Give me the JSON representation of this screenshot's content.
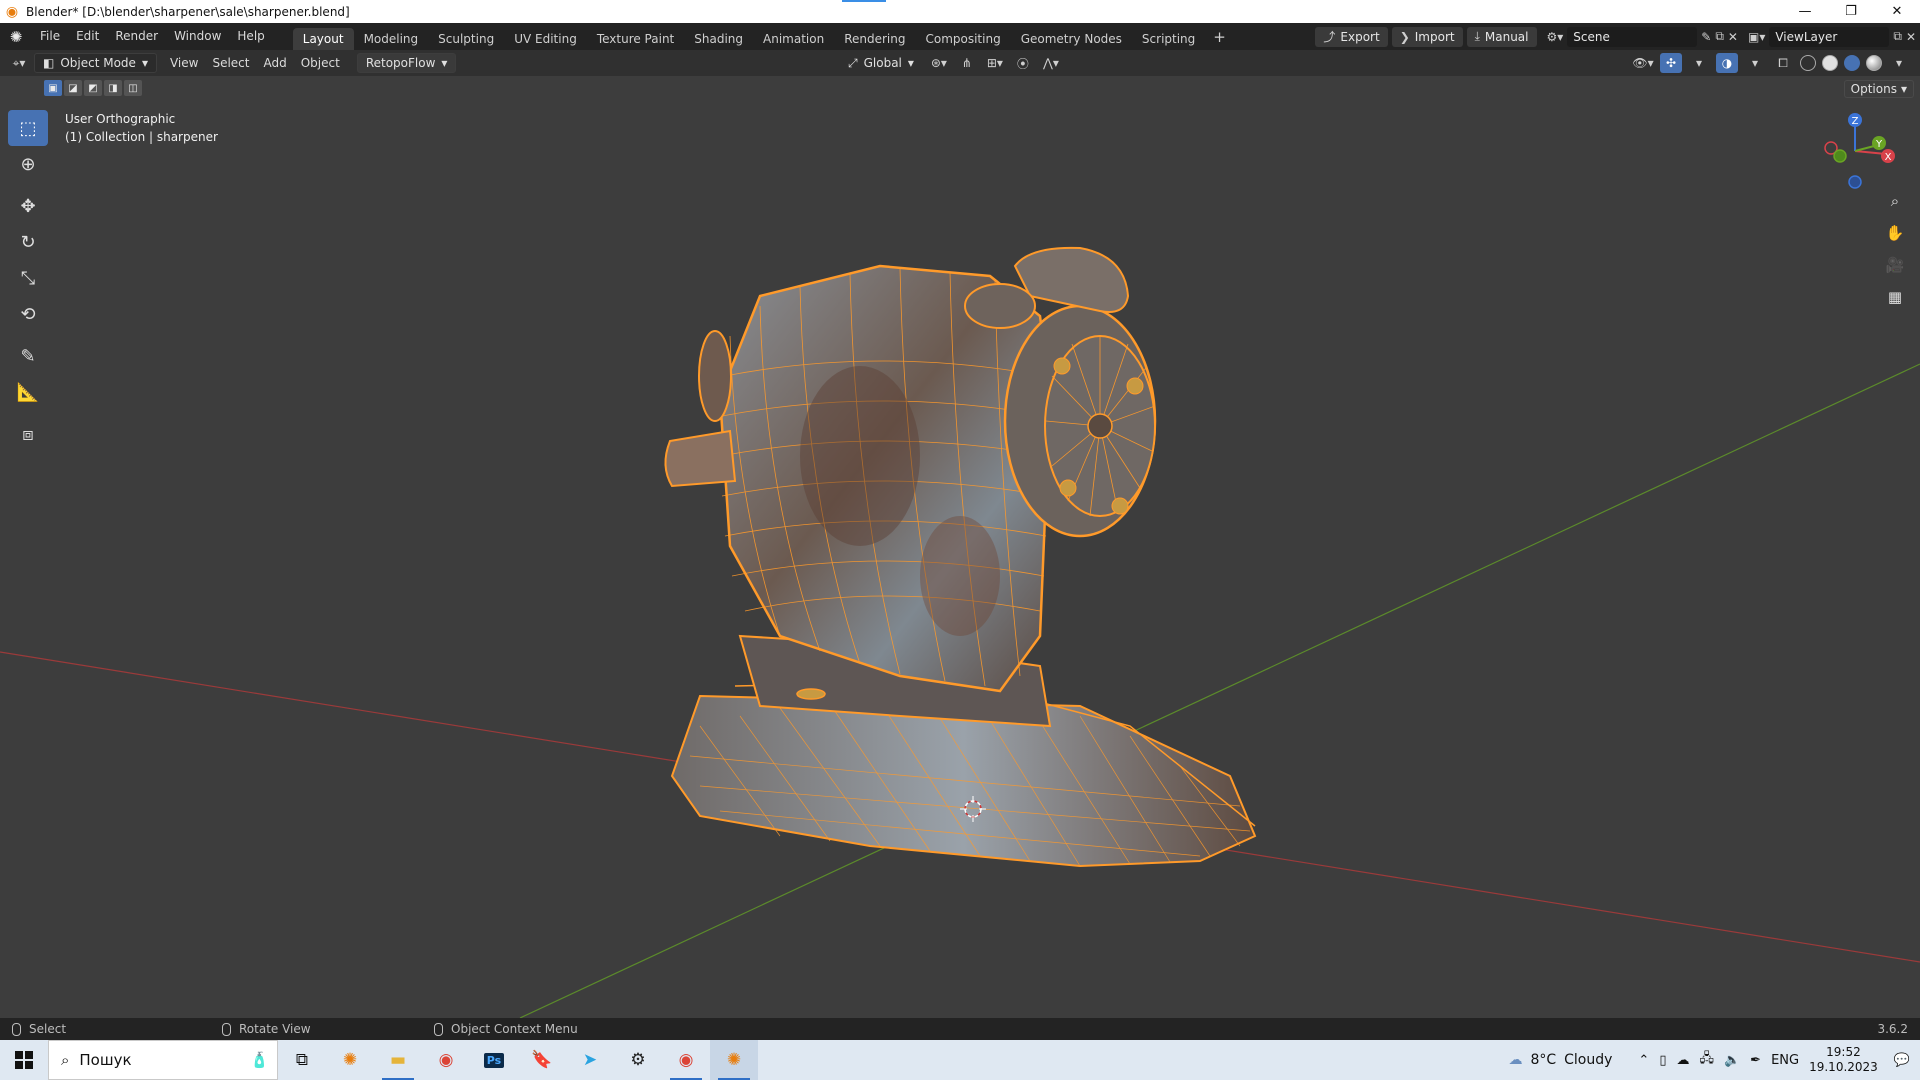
{
  "window": {
    "title": "Blender* [D:\\blender\\sharpener\\sale\\sharpener.blend]",
    "app_icon": "blender-icon",
    "buttons": [
      "minimize",
      "restore",
      "close"
    ]
  },
  "menu": {
    "items": [
      "File",
      "Edit",
      "Render",
      "Window",
      "Help"
    ]
  },
  "workspaces": {
    "tabs": [
      "Layout",
      "Modeling",
      "Sculpting",
      "UV Editing",
      "Texture Paint",
      "Shading",
      "Animation",
      "Rendering",
      "Compositing",
      "Geometry Nodes",
      "Scripting"
    ],
    "active": "Layout",
    "add_label": "+"
  },
  "topbar_right": {
    "export_label": "Export",
    "import_label": "Import",
    "manual_label": "Manual",
    "scene_name": "Scene",
    "view_layer": "ViewLayer"
  },
  "viewport_header": {
    "mode": "Object Mode",
    "menus": [
      "View",
      "Select",
      "Add",
      "Object"
    ],
    "addon_menu": "RetopoFlow",
    "transform_orientation": "Global",
    "options_label": "Options"
  },
  "viewport": {
    "view_name": "User Orthographic",
    "collection_info": "(1) Collection | sharpener",
    "object_name": "sharpener",
    "mesh_color": "#ff9a2a",
    "x_axis_color": "#9b3a3a",
    "y_axis_color": "#5b8a2b",
    "background": "#3d3d3d",
    "gizmo": {
      "x": "X",
      "y": "Y",
      "z": "Z"
    }
  },
  "toolbar": {
    "tools": [
      "select-box-icon",
      "cursor-icon",
      "move-icon",
      "rotate-icon",
      "scale-icon",
      "transform-icon",
      "annotate-icon",
      "measure-icon",
      "add-cube-icon"
    ],
    "active": "select-box-icon"
  },
  "statusbar": {
    "select_label": "Select",
    "rotate_label": "Rotate View",
    "context_label": "Object Context Menu",
    "version": "3.6.2"
  },
  "taskbar": {
    "search_placeholder": "Пошук",
    "weather": {
      "temp": "8°C",
      "desc": "Cloudy"
    },
    "language": "ENG",
    "time": "19:52",
    "date": "19.10.2023",
    "apps": [
      "blender-taskbar-icon",
      "file-explorer-icon",
      "chrome-icon",
      "photoshop-icon",
      "bookmark-icon",
      "telegram-icon",
      "steam-icon",
      "chrome-profile-icon",
      "blender-active-icon"
    ]
  }
}
